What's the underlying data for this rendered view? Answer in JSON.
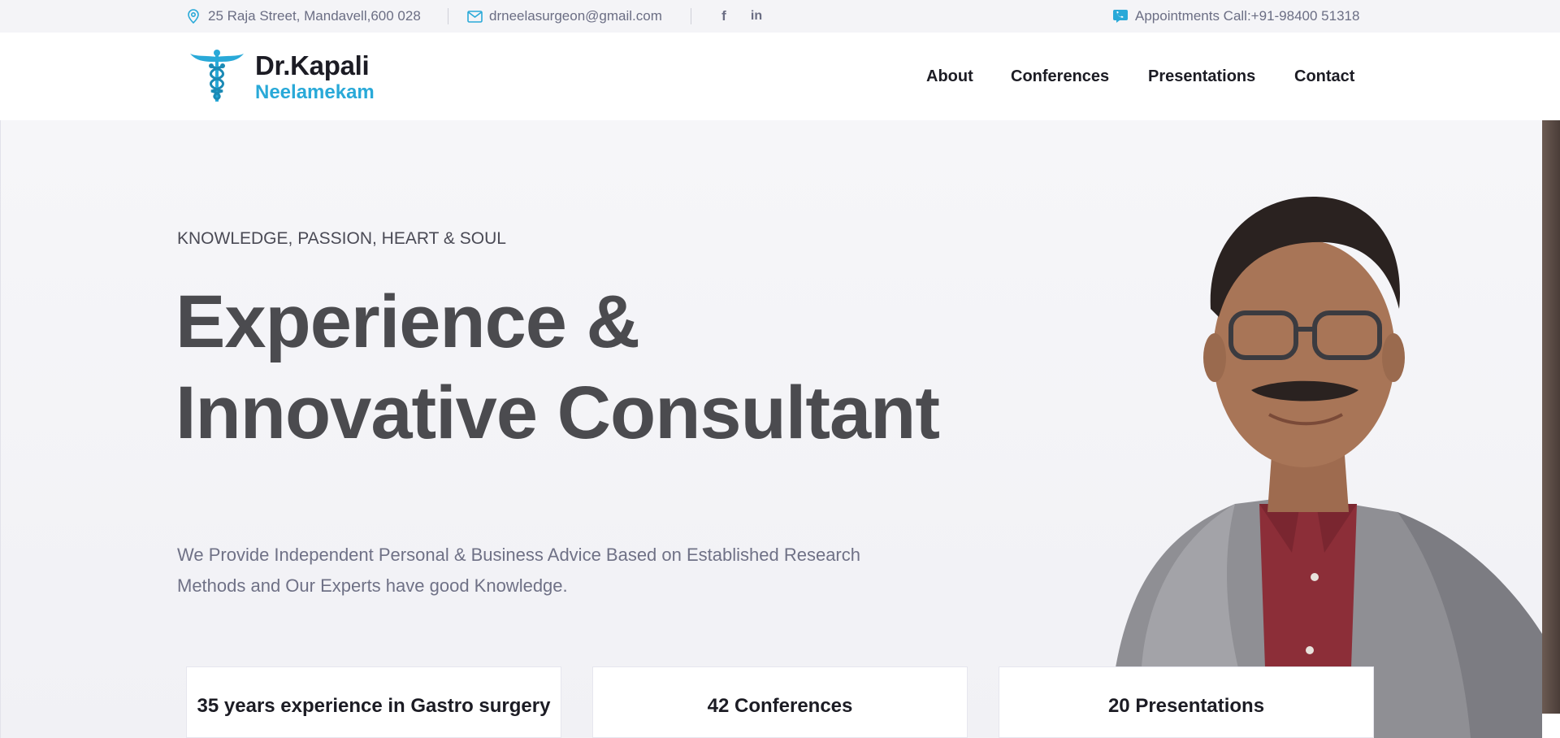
{
  "topbar": {
    "address": "25 Raja Street, Mandavell,600 028",
    "email": "drneelasurgeon@gmail.com",
    "social": {
      "facebook": "f",
      "linkedin": "in"
    },
    "appointments": "Appointments Call:+91-98400 51318"
  },
  "logo": {
    "name_line1": "Dr.Kapali",
    "name_line2": "Neelamekam"
  },
  "nav": [
    "About",
    "Conferences",
    "Presentations",
    "Contact"
  ],
  "hero": {
    "tagline": "KNOWLEDGE, PASSION, HEART & SOUL",
    "headline_line1": "Experience &",
    "headline_line2": "Innovative Consultant",
    "lead_line1": "We Provide Independent Personal & Business Advice Based on Established Research",
    "lead_line2": "Methods and Our Experts have good Knowledge."
  },
  "stats": [
    "35 years experience in Gastro surgery",
    "42 Conferences",
    "20 Presentations"
  ],
  "colors": {
    "brand": "#29a9d8",
    "text_dark": "#1c1c24",
    "muted": "#6b6e84"
  }
}
